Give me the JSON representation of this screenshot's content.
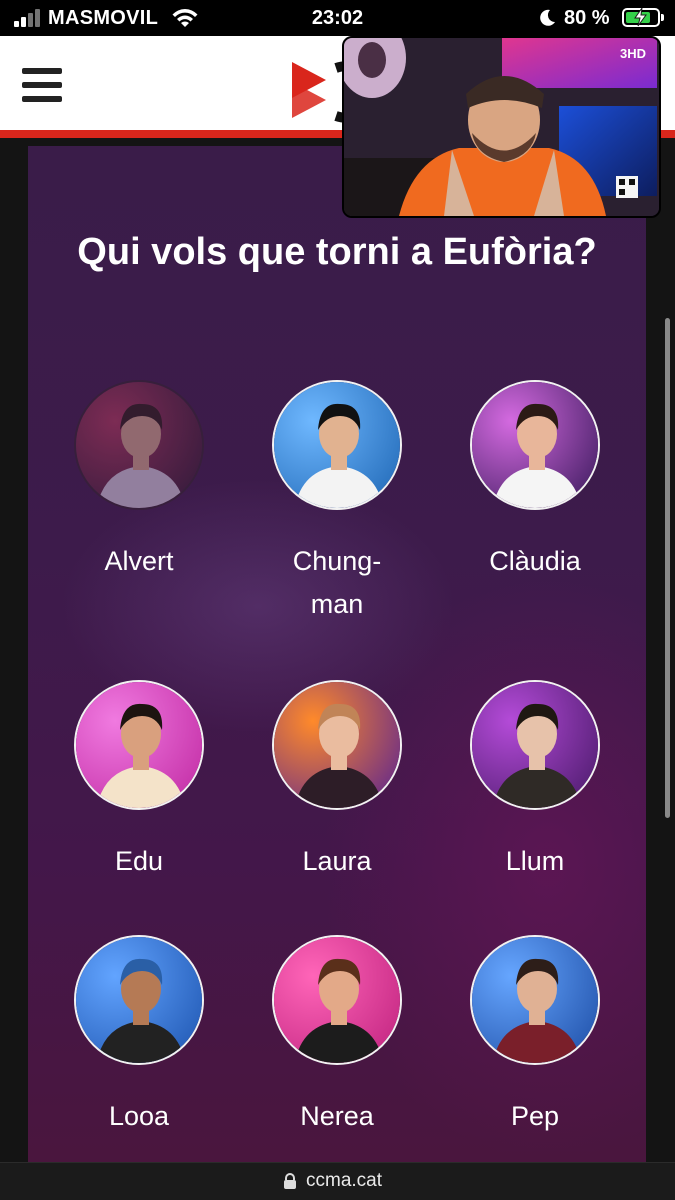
{
  "status_bar": {
    "carrier": "MASMOVIL",
    "time": "23:02",
    "battery_percent": "80 %",
    "battery_level": 0.8,
    "icons": [
      "signal-icon",
      "wifi-icon",
      "moon-icon",
      "battery-charging-icon"
    ]
  },
  "header": {
    "menu_icon": "hamburger-menu-icon",
    "logo": "3cat-logo"
  },
  "pip": {
    "overlay": "3HD"
  },
  "poll": {
    "title": "Qui vols que torni a Eufòria?",
    "contestants": [
      {
        "name": "Alvert",
        "bg": "#2a1a2f",
        "accent": "#b23a5d",
        "shirt": "#d9d1e2",
        "hair": "#2d1d17",
        "skin": "#d8a98e"
      },
      {
        "name": "Chung-man",
        "bg": "#1f67b5",
        "accent": "#6fb8ff",
        "shirt": "#f3f3f3",
        "hair": "#111111",
        "skin": "#e1b290"
      },
      {
        "name": "Clàudia",
        "bg": "#3b1a5d",
        "accent": "#d46ae0",
        "shirt": "#f5f5f5",
        "hair": "#2b1a15",
        "skin": "#e8b69a"
      },
      {
        "name": "Edu",
        "bg": "#c12aa3",
        "accent": "#f07ae0",
        "shirt": "#f4e3c9",
        "hair": "#1d1410",
        "skin": "#d9a07e"
      },
      {
        "name": "Laura",
        "bg": "#5b2391",
        "accent": "#ff8a2a",
        "shirt": "#2d1d27",
        "hair": "#c18457",
        "skin": "#eabc9f"
      },
      {
        "name": "Llum",
        "bg": "#4a1a6a",
        "accent": "#b44bd8",
        "shirt": "#2f2a26",
        "hair": "#1f1812",
        "skin": "#e7c2aa"
      },
      {
        "name": "Looa",
        "bg": "#1e55b0",
        "accent": "#62a4ff",
        "shirt": "#222222",
        "hair": "#2a5fa6",
        "skin": "#b57a55"
      },
      {
        "name": "Nerea",
        "bg": "#c0237f",
        "accent": "#ff65b8",
        "shirt": "#1c1c1c",
        "hair": "#5a2f1a",
        "skin": "#e3a988"
      },
      {
        "name": "Pep",
        "bg": "#1e4ea6",
        "accent": "#66a6ff",
        "shirt": "#7a1f2a",
        "hair": "#2d1e19",
        "skin": "#e0b194"
      }
    ]
  },
  "browser": {
    "url": "ccma.cat",
    "lock_icon": "lock-icon"
  }
}
